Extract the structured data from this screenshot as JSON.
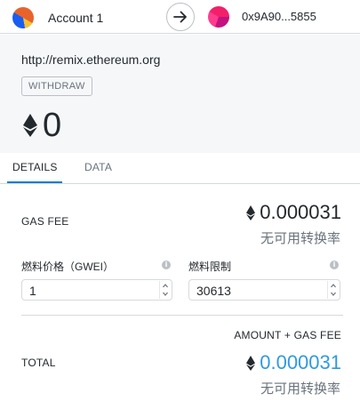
{
  "header": {
    "account_name": "Account 1",
    "recipient_address": "0x9A90...5855"
  },
  "summary": {
    "origin": "http://remix.ethereum.org",
    "method": "WITHDRAW",
    "amount": "0"
  },
  "tabs": [
    {
      "label": "DETAILS",
      "active": true
    },
    {
      "label": "DATA",
      "active": false
    }
  ],
  "gas_fee": {
    "label": "GAS FEE",
    "value": "0.000031",
    "conversion": "无可用转换率"
  },
  "gas_price": {
    "label": "燃料价格（GWEI）",
    "value": "1"
  },
  "gas_limit": {
    "label": "燃料限制",
    "value": "30613"
  },
  "total": {
    "header": "AMOUNT + GAS FEE",
    "label": "TOTAL",
    "value": "0.000031",
    "conversion": "无可用转换率"
  },
  "icons": {
    "eth": "ethereum-diamond-icon",
    "arrow": "arrow-right-icon",
    "info": "info-icon"
  },
  "colors": {
    "accent": "#037dd6",
    "total_value": "#2f9ae0"
  }
}
